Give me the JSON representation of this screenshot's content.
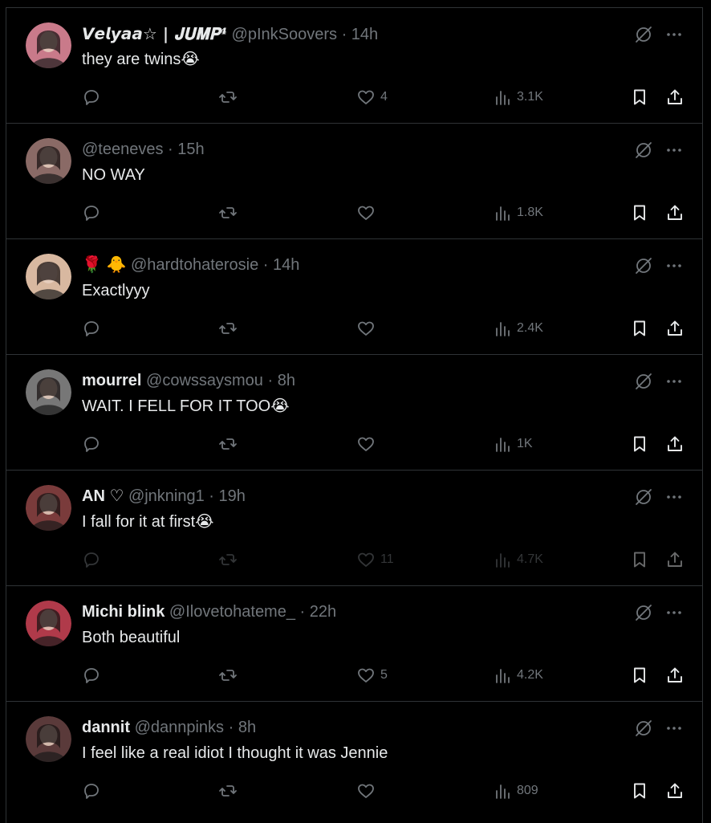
{
  "replies": [
    {
      "name": "𝙑𝙚𝙡𝙮𝙖𝙖☆ | 𝐉𝐔𝐌𝐏⁴",
      "handle": "@pInkSoovers",
      "time": "14h",
      "text": "they are twins",
      "emoji": "😭",
      "likes": "4",
      "views": "3.1K",
      "avatar_color": "#c97a8a"
    },
    {
      "name": "",
      "handle": "@teeneves",
      "time": "15h",
      "text": "NO WAY",
      "emoji": "",
      "likes": "",
      "views": "1.8K",
      "avatar_color": "#8a6a66"
    },
    {
      "name": "🌹 🐥",
      "handle": "@hardtohaterosie",
      "time": "14h",
      "text": "Exactlyyy",
      "emoji": "",
      "likes": "",
      "views": "2.4K",
      "avatar_color": "#d8b8a0"
    },
    {
      "name": "mourrel",
      "handle": "@cowssaysmou",
      "time": "8h",
      "text": "WAIT. I FELL FOR IT TOO",
      "emoji": "😭",
      "likes": "",
      "views": "1K",
      "avatar_color": "#777777"
    },
    {
      "name": "AN ♡",
      "handle": "@jnkning1",
      "time": "19h",
      "text": "I fall for it at first",
      "emoji": "😭",
      "likes": "11",
      "views": "4.7K",
      "avatar_color": "#7a3b3b"
    },
    {
      "name": "Michi blink",
      "handle": "@Ilovetohateme_",
      "time": "22h",
      "text": "Both beautiful",
      "emoji": "",
      "likes": "5",
      "views": "4.2K",
      "avatar_color": "#b03a4a"
    },
    {
      "name": "dannit",
      "handle": "@dannpinks",
      "time": "8h",
      "text": "I feel like a real idiot I thought it was Jennie",
      "emoji": "",
      "likes": "",
      "views": "809",
      "avatar_color": "#5a3a3a"
    }
  ],
  "icons": {
    "reply": "reply-bubble-icon",
    "retweet": "retweet-icon",
    "like": "heart-icon",
    "views": "views-bars-icon",
    "bookmark": "bookmark-icon",
    "share": "share-upload-icon",
    "grok": "grok-slash-icon",
    "more": "more-dots-icon"
  },
  "colors": {
    "background": "#000000",
    "text": "#e7e9ea",
    "muted": "#71767b",
    "border": "#2f3336"
  }
}
